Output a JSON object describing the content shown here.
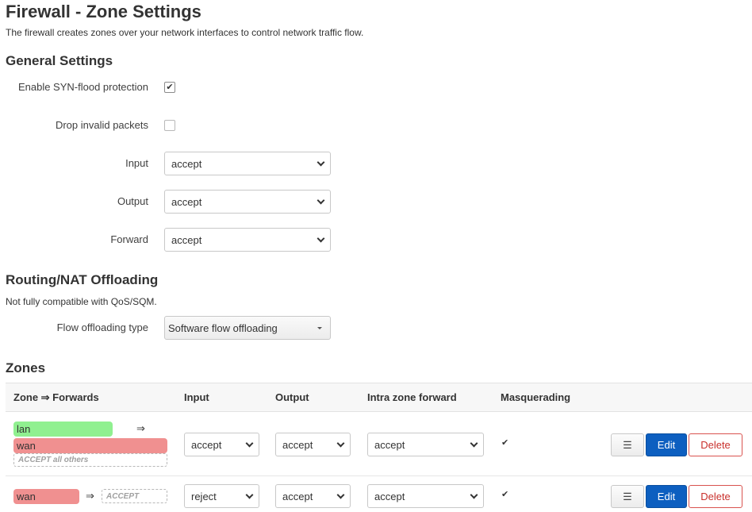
{
  "page": {
    "title": "Firewall - Zone Settings",
    "description": "The firewall creates zones over your network interfaces to control network traffic flow."
  },
  "general": {
    "heading": "General Settings",
    "syn_flood_label": "Enable SYN-flood protection",
    "syn_flood_checked": true,
    "drop_invalid_label": "Drop invalid packets",
    "drop_invalid_checked": false,
    "input_label": "Input",
    "input_value": "accept",
    "output_label": "Output",
    "output_value": "accept",
    "forward_label": "Forward",
    "forward_value": "accept"
  },
  "offload": {
    "heading": "Routing/NAT Offloading",
    "note": "Not fully compatible with QoS/SQM.",
    "type_label": "Flow offloading type",
    "type_value": "Software flow offloading"
  },
  "zones": {
    "heading": "Zones",
    "columns": [
      "Zone ⇒ Forwards",
      "Input",
      "Output",
      "Intra zone forward",
      "Masquerading"
    ],
    "rows": [
      {
        "zone": "lan",
        "zone_color": "#90f090",
        "arrow": "⇒",
        "forwards": [
          "wan"
        ],
        "forward_colors": [
          "#f09090"
        ],
        "default_forward": "ACCEPT all others",
        "input": "accept",
        "output": "accept",
        "intra": "accept",
        "masquerading": true
      },
      {
        "zone": "wan",
        "zone_color": "#f09090",
        "arrow": "⇒",
        "forwards": [],
        "default_forward": "ACCEPT",
        "input": "reject",
        "output": "accept",
        "intra": "accept",
        "masquerading": true
      }
    ],
    "menu_icon": "☰",
    "edit_label": "Edit",
    "delete_label": "Delete"
  },
  "icons": {
    "check": "✔",
    "chevron": "chevron-down-icon",
    "menu": "menu-icon"
  }
}
